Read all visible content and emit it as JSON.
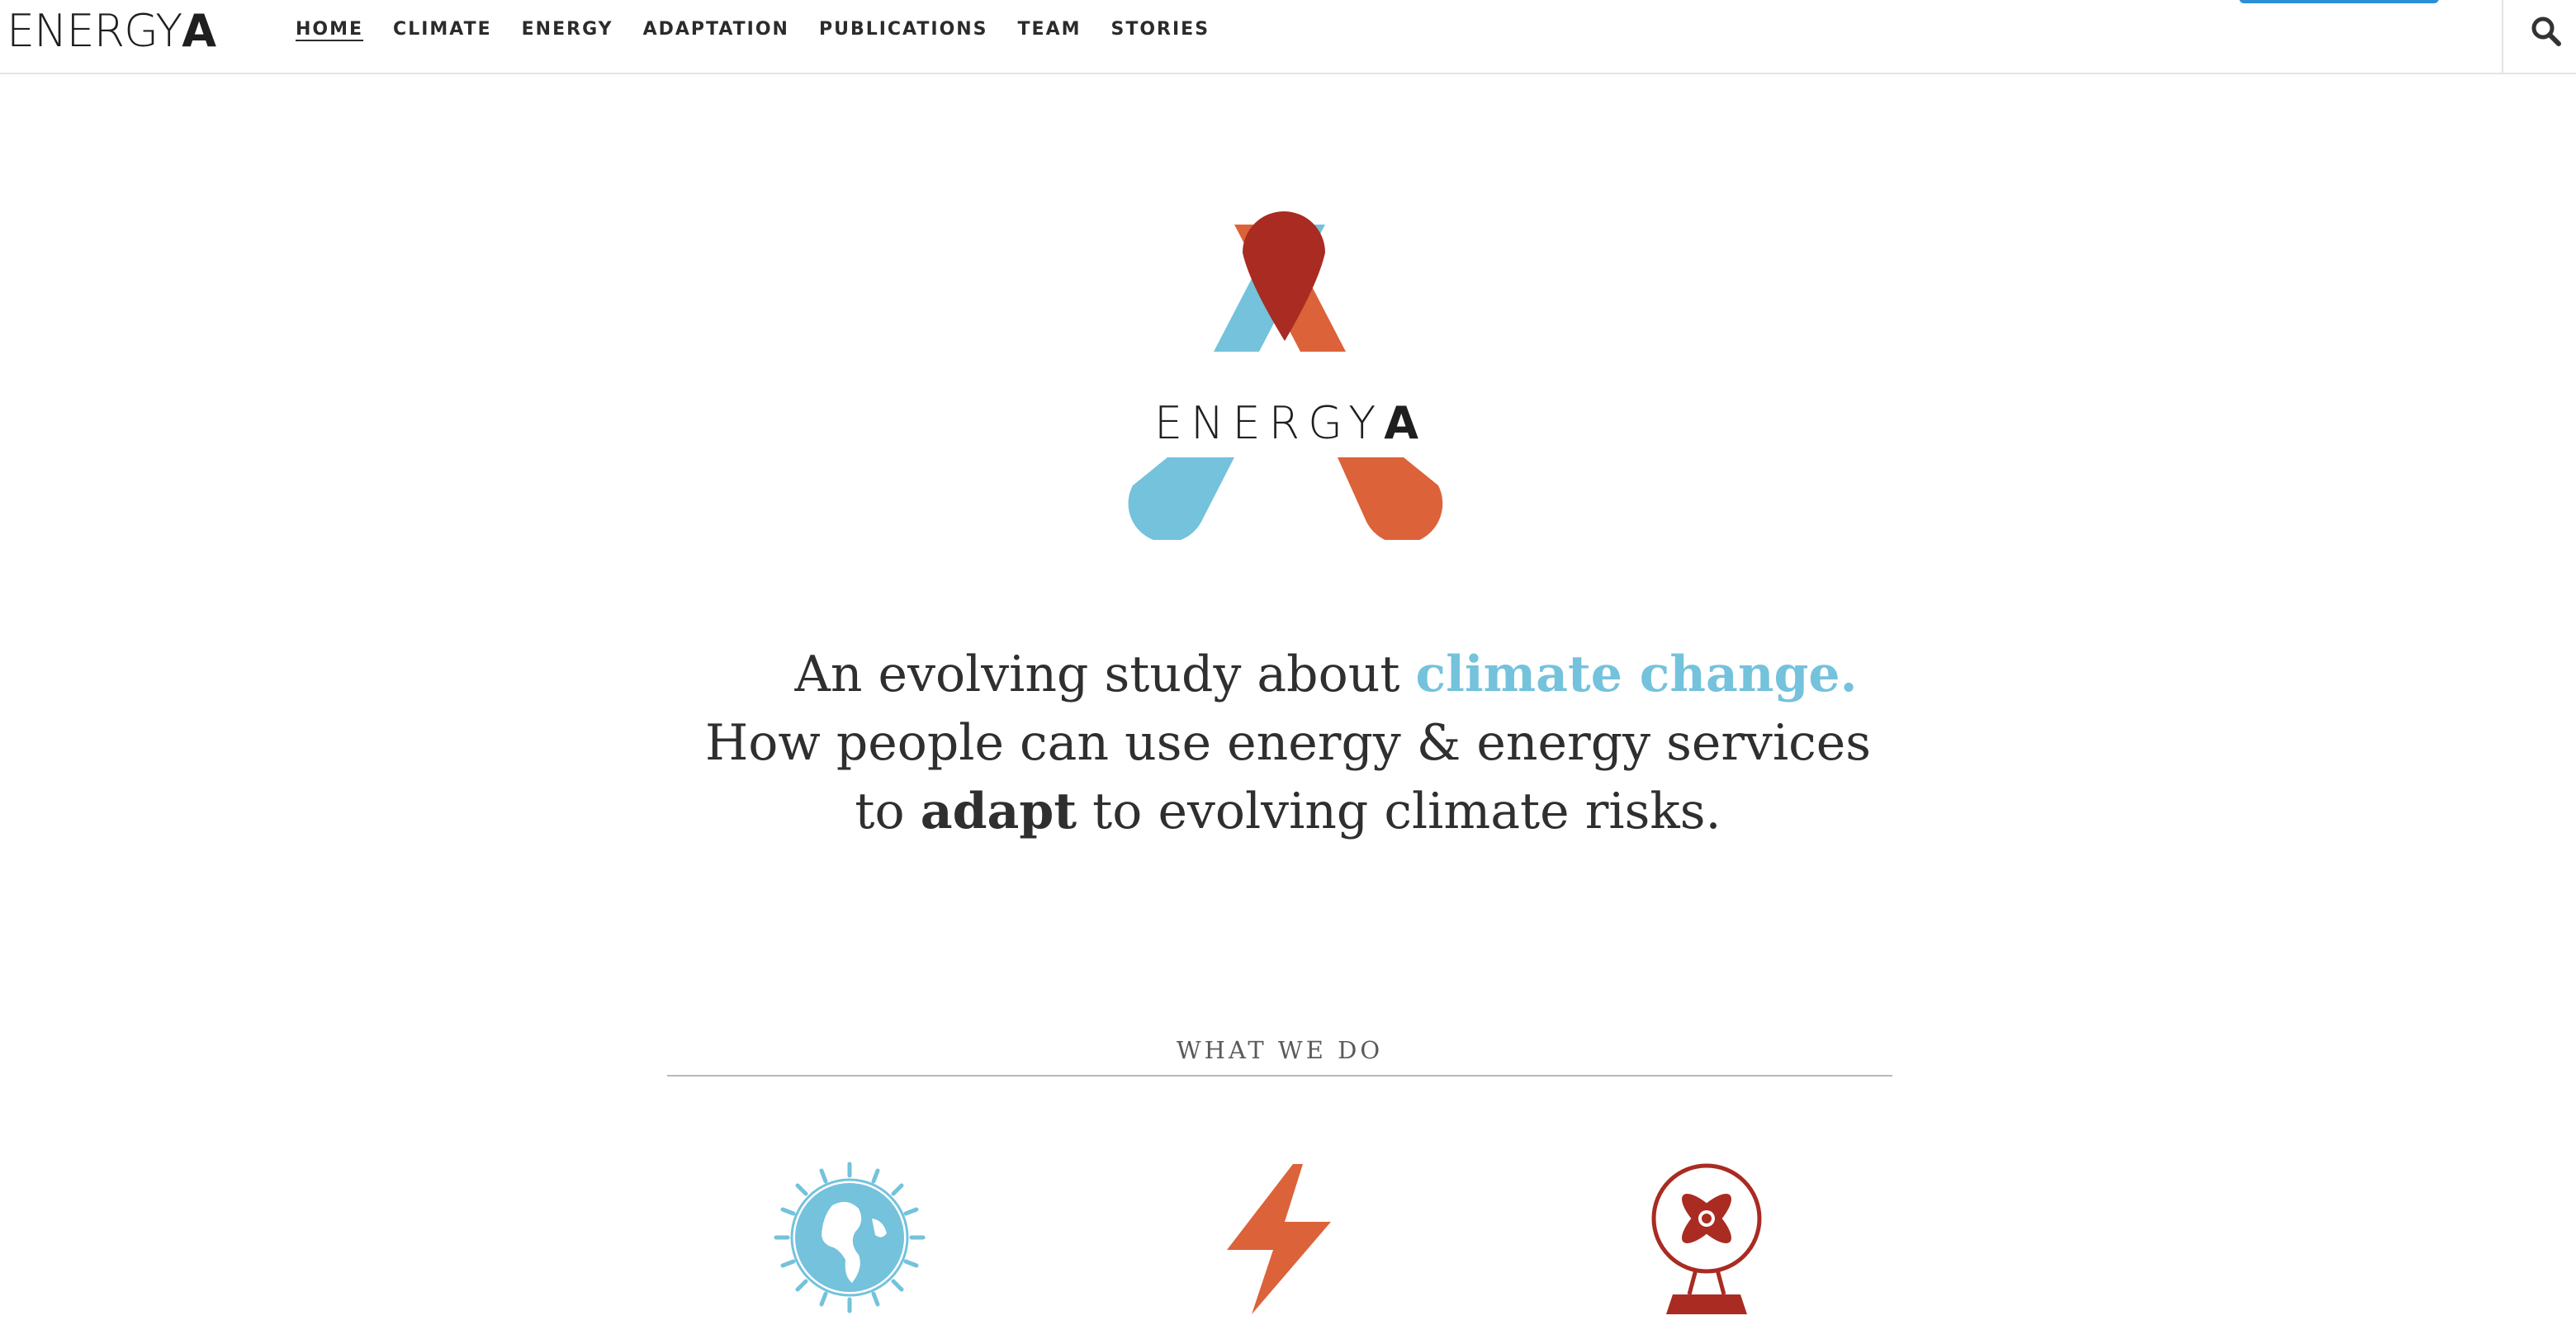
{
  "header": {
    "brand_light": "ENERGY",
    "brand_bold": "A",
    "nav": [
      {
        "label": "HOME"
      },
      {
        "label": "CLIMATE"
      },
      {
        "label": "ENERGY"
      },
      {
        "label": "ADAPTATION"
      },
      {
        "label": "PUBLICATIONS"
      },
      {
        "label": "TEAM"
      },
      {
        "label": "STORIES"
      }
    ],
    "active_nav": "HOME",
    "search_icon": "search-icon"
  },
  "hero": {
    "logo_word_light": "ENERGY",
    "logo_word_bold": "A",
    "tagline": {
      "l1_pre": "An evolving study about ",
      "l1_accent": "climate change.",
      "l2": "How people can use energy & energy services",
      "l3_pre": "to ",
      "l3_bold": "adapt",
      "l3_post": " to evolving climate risks."
    }
  },
  "what_we_do": {
    "title": "WHAT WE DO",
    "icons": [
      "globe-sun-icon",
      "lightning-bolt-icon",
      "electric-fan-icon"
    ]
  },
  "colors": {
    "light_blue": "#74c2dc",
    "orange": "#dc623a",
    "dark_red": "#a92b22",
    "text": "#333333"
  }
}
